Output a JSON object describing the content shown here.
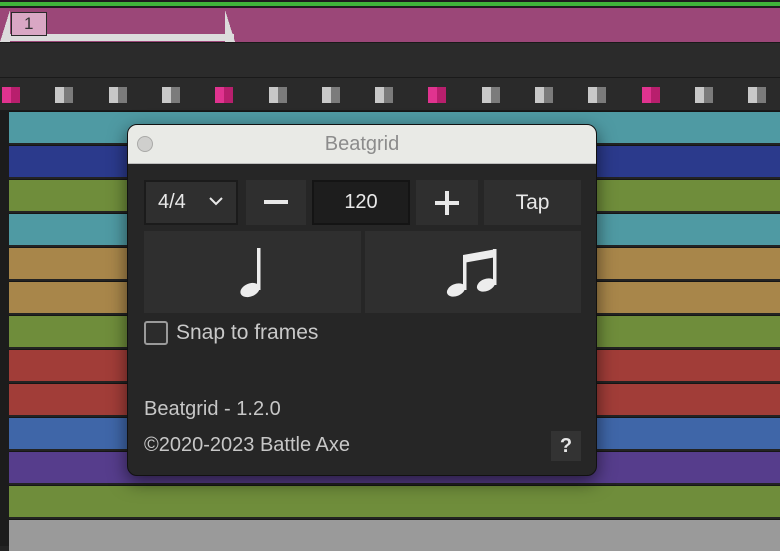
{
  "timeline": {
    "marker_label": "1",
    "beats": [
      "bar",
      "norm",
      "norm",
      "norm",
      "bar",
      "norm",
      "norm",
      "norm",
      "bar",
      "norm",
      "norm",
      "norm",
      "bar",
      "norm",
      "norm"
    ],
    "layer_colors": [
      "#4f9aa3",
      "#2b3a8c",
      "#6f8d3b",
      "#4f9aa3",
      "#a8864a",
      "#a8864a",
      "#6f8d3b",
      "#a13d38",
      "#a13d38",
      "#3f66a8",
      "#563d8c",
      "#6f8d3b",
      "#9a9a9a"
    ],
    "colors": {
      "work_area": "#9b4778",
      "top_bar": "#3fb53a",
      "bar_beat": "#e0338f"
    }
  },
  "dialog": {
    "title": "Beatgrid",
    "time_signature": "4/4",
    "bpm": "120",
    "tap_label": "Tap",
    "snap_label": "Snap to frames",
    "snap_checked": false,
    "version": "Beatgrid - 1.2.0",
    "copyright": "©2020-2023 Battle Axe",
    "help_label": "?",
    "icons": {
      "minus": "minus-icon",
      "plus": "plus-icon",
      "quarter_note": "quarter-note-icon",
      "eighth_notes": "beamed-eighth-notes-icon",
      "dropdown": "chevron-down-icon",
      "close": "close-icon"
    }
  }
}
